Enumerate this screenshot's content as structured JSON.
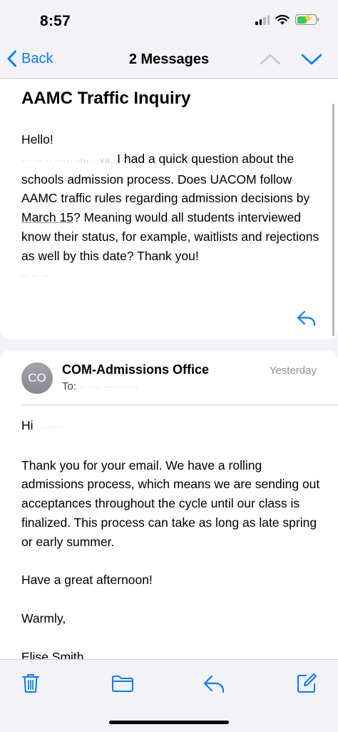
{
  "status": {
    "time": "8:57"
  },
  "nav": {
    "back_label": "Back",
    "title": "2 Messages"
  },
  "message1": {
    "subject": "AAMC Traffic Inquiry",
    "greeting": "Hello!",
    "redacted_name": "··· ·· ·· ····· ·ıı· ··va,",
    "body": "I had a quick question about the schools admission process. Does UACOM follow AAMC traffic rules regarding admission decisions by",
    "date_link": "March 15",
    "body_after": "? Meaning would all students interviewed know their status, for example, waitlists and rejections as well by this date? Thank you!",
    "signature_redacted": "·· ·· ··"
  },
  "message2": {
    "avatar_initials": "CO",
    "sender": "COM-Admissions Office",
    "date": "Yesterday",
    "to_prefix": "To:",
    "to_redacted": "·· ··· ···· ·····",
    "greeting_prefix": "Hi",
    "greeting_redacted": "·· ·····",
    "paragraph1": "Thank you for your email. We have a rolling admissions process, which means we are sending out acceptances throughout the cycle until our class is finalized. This process can take as long as late spring or early summer.",
    "paragraph2": "Have a great afternoon!",
    "paragraph3": "Warmly,",
    "paragraph4": "Elise Smith"
  },
  "colors": {
    "accent": "#0a7aff",
    "battery": "#34c759"
  }
}
